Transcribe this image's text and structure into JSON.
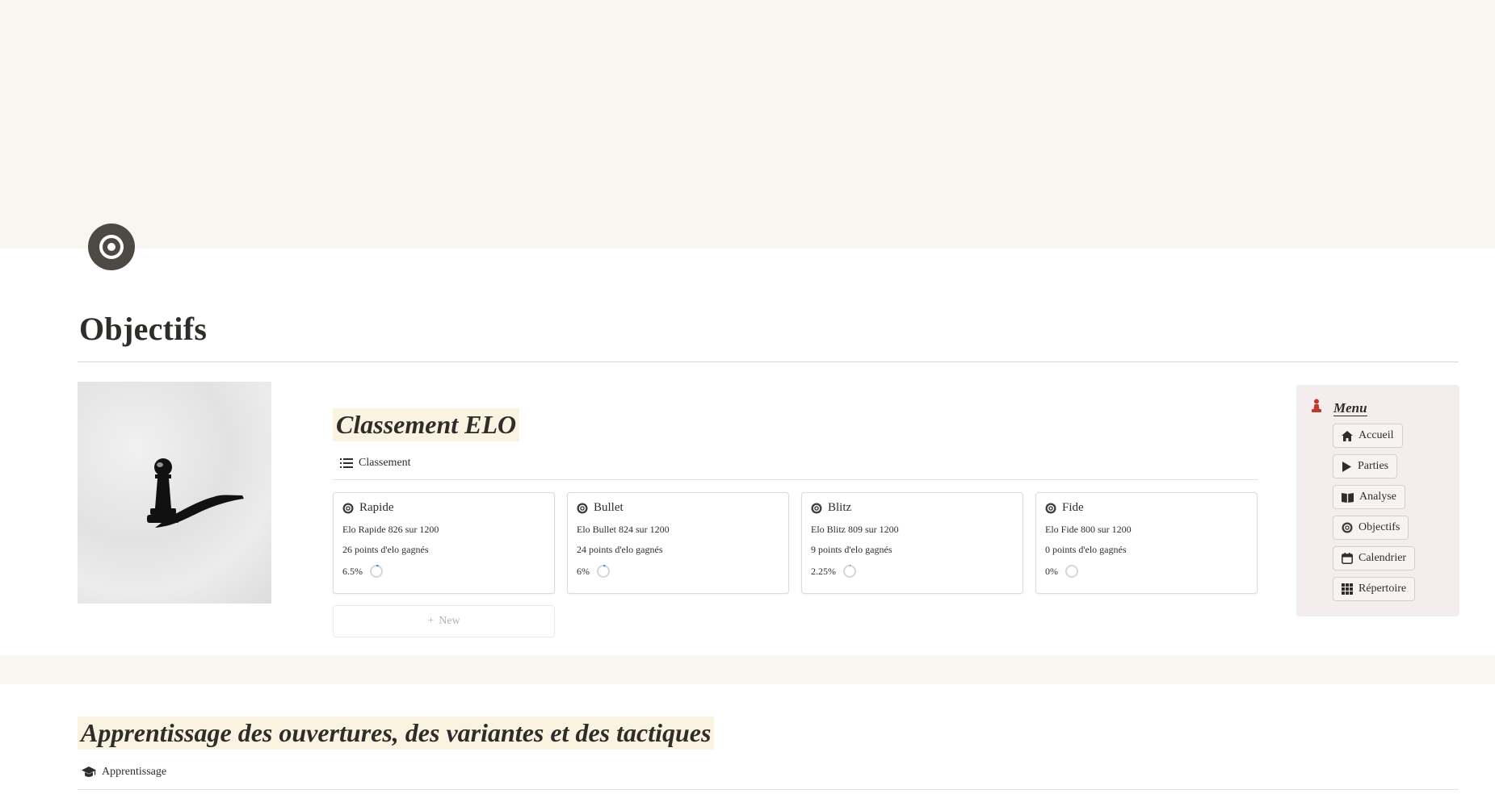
{
  "page": {
    "title": "Objectifs",
    "icon": "target-icon"
  },
  "elo_section": {
    "heading": "Classement ELO",
    "view_tab": "Classement",
    "new_label": "New",
    "cards": [
      {
        "name": "Rapide",
        "elo_line": "Elo Rapide 826 sur 1200",
        "gain_line": "26 points d'elo gagnés",
        "progress_text": "6.5%",
        "progress": 0.065
      },
      {
        "name": "Bullet",
        "elo_line": "Elo Bullet 824 sur 1200",
        "gain_line": "24 points d'elo gagnés",
        "progress_text": "6%",
        "progress": 0.06
      },
      {
        "name": "Blitz",
        "elo_line": "Elo Blitz 809 sur 1200",
        "gain_line": "9 points d'elo gagnés",
        "progress_text": "2.25%",
        "progress": 0.0225
      },
      {
        "name": "Fide",
        "elo_line": "Elo Fide 800 sur 1200",
        "gain_line": "0 points d'elo gagnés",
        "progress_text": "0%",
        "progress": 0
      }
    ]
  },
  "menu": {
    "title": "Menu",
    "items": [
      {
        "label": "Accueil",
        "icon": "home-icon"
      },
      {
        "label": "Parties",
        "icon": "play-icon"
      },
      {
        "label": "Analyse",
        "icon": "book-icon"
      },
      {
        "label": "Objectifs",
        "icon": "target-icon"
      },
      {
        "label": "Calendrier",
        "icon": "calendar-icon"
      },
      {
        "label": "Répertoire",
        "icon": "grid-icon"
      }
    ]
  },
  "learning_section": {
    "heading": "Apprentissage des ouvertures, des variantes et des tactiques",
    "view_tab": "Apprentissage"
  },
  "colors": {
    "cover": "#f7f6f1",
    "highlight": "#fbf3e1",
    "menu_bg": "#f3eded",
    "pawn_red": "#c0392b",
    "progress_blue": "#4a90d9",
    "progress_track": "#d6d6d6"
  }
}
